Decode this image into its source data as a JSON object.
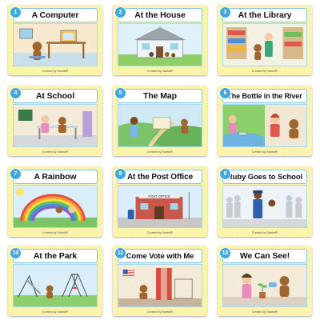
{
  "books": [
    {
      "number": "1",
      "title": "A Computer",
      "credit": "Created by Starfall®"
    },
    {
      "number": "2",
      "title": "At the House",
      "credit": "Created by Starfall®"
    },
    {
      "number": "3",
      "title": "At the Library",
      "credit": "Created by Starfall®"
    },
    {
      "number": "4",
      "title": "At School",
      "credit": "Created by Starfall®"
    },
    {
      "number": "5",
      "title": "The Map",
      "credit": "Created by Starfall®"
    },
    {
      "number": "6",
      "title": "The Bottle in the River",
      "credit": "Created by Starfall®"
    },
    {
      "number": "7",
      "title": "A Rainbow",
      "credit": "Created by Starfall®"
    },
    {
      "number": "8",
      "title": "At the Post Office",
      "credit": "Created by Starfall®"
    },
    {
      "number": "9",
      "title": "Ruby Goes to School",
      "credit": "Created by Starfall®"
    },
    {
      "number": "10",
      "title": "At the Park",
      "credit": "Created by Starfall®"
    },
    {
      "number": "11",
      "title": "Come Vote with Me",
      "credit": "Created by Starfall®"
    },
    {
      "number": "12",
      "title": "We Can See!",
      "credit": "Created by Starfall®"
    }
  ],
  "signs": {
    "post_office": "POST OFFICE"
  },
  "colors": {
    "cover": "#fbf3a8",
    "frame": "#79c7ea",
    "badge": "#3fa9df"
  }
}
